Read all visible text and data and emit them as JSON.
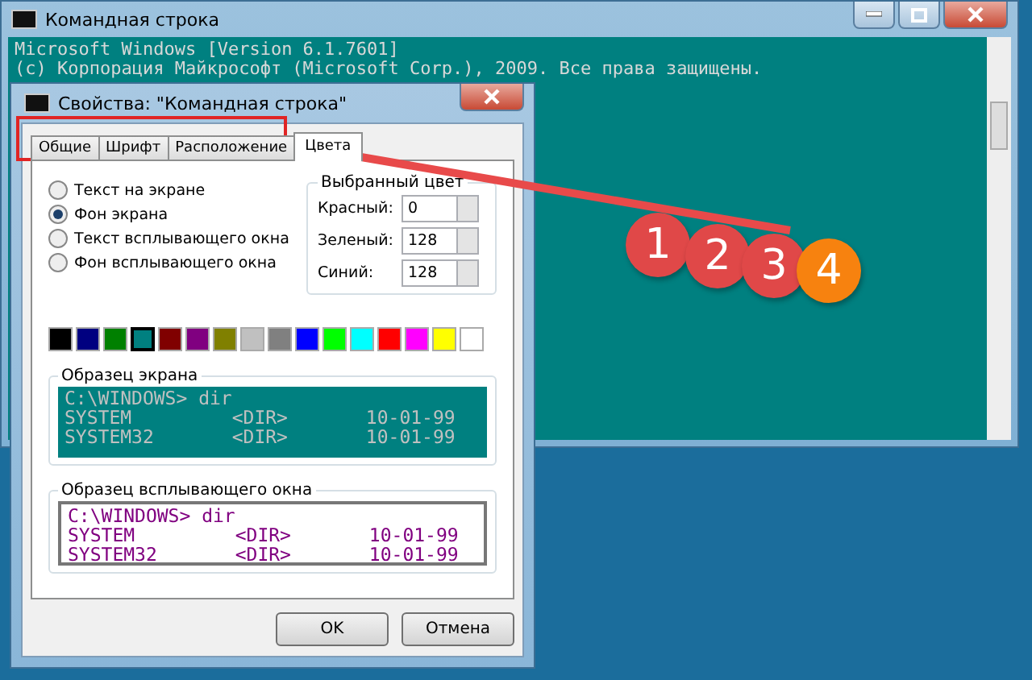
{
  "console_window": {
    "title": "Командная строка",
    "lines": [
      "Microsoft Windows [Version 6.1.7601]",
      "(c) Корпорация Майкрософт (Microsoft Corp.), 2009. Все права защищены."
    ]
  },
  "dialog": {
    "title": "Свойства: \"Командная строка\"",
    "tabs": [
      {
        "label": "Общие",
        "selected": false
      },
      {
        "label": "Шрифт",
        "selected": false
      },
      {
        "label": "Расположение",
        "selected": false
      },
      {
        "label": "Цвета",
        "selected": true
      }
    ],
    "targets": [
      {
        "label": "Текст на экране",
        "selected": false
      },
      {
        "label": "Фон экрана",
        "selected": true
      },
      {
        "label": "Текст всплывающего окна",
        "selected": false
      },
      {
        "label": "Фон всплывающего окна",
        "selected": false
      }
    ],
    "selected_color": {
      "title": "Выбранный цвет",
      "fields": [
        {
          "label": "Красный:",
          "value": "0"
        },
        {
          "label": "Зеленый:",
          "value": "128"
        },
        {
          "label": "Синий:",
          "value": "128"
        }
      ]
    },
    "palette": [
      {
        "color": "#000000",
        "selected": false
      },
      {
        "color": "#000080",
        "selected": false
      },
      {
        "color": "#008000",
        "selected": false
      },
      {
        "color": "#008080",
        "selected": true
      },
      {
        "color": "#800000",
        "selected": false
      },
      {
        "color": "#800080",
        "selected": false
      },
      {
        "color": "#808000",
        "selected": false
      },
      {
        "color": "#c0c0c0",
        "selected": false
      },
      {
        "color": "#808080",
        "selected": false
      },
      {
        "color": "#0000ff",
        "selected": false
      },
      {
        "color": "#00ff00",
        "selected": false
      },
      {
        "color": "#00ffff",
        "selected": false
      },
      {
        "color": "#ff0000",
        "selected": false
      },
      {
        "color": "#ff00ff",
        "selected": false
      },
      {
        "color": "#ffff00",
        "selected": false
      },
      {
        "color": "#ffffff",
        "selected": false
      }
    ],
    "screen_sample": {
      "title": "Образец экрана",
      "lines": [
        "C:\\WINDOWS> dir",
        "SYSTEM         <DIR>       10-01-99",
        "SYSTEM32       <DIR>       10-01-99"
      ]
    },
    "popup_sample": {
      "title": "Образец всплывающего окна",
      "lines": [
        "C:\\WINDOWS> dir",
        "SYSTEM         <DIR>       10-01-99",
        "SYSTEM32       <DIR>       10-01-99"
      ]
    },
    "buttons": [
      "OK",
      "Отмена"
    ]
  },
  "badges": [
    {
      "label": "1",
      "color": "#e04848"
    },
    {
      "label": "2",
      "color": "#e04848"
    },
    {
      "label": "3",
      "color": "#e04848"
    },
    {
      "label": "4",
      "color": "#f7820f"
    }
  ]
}
